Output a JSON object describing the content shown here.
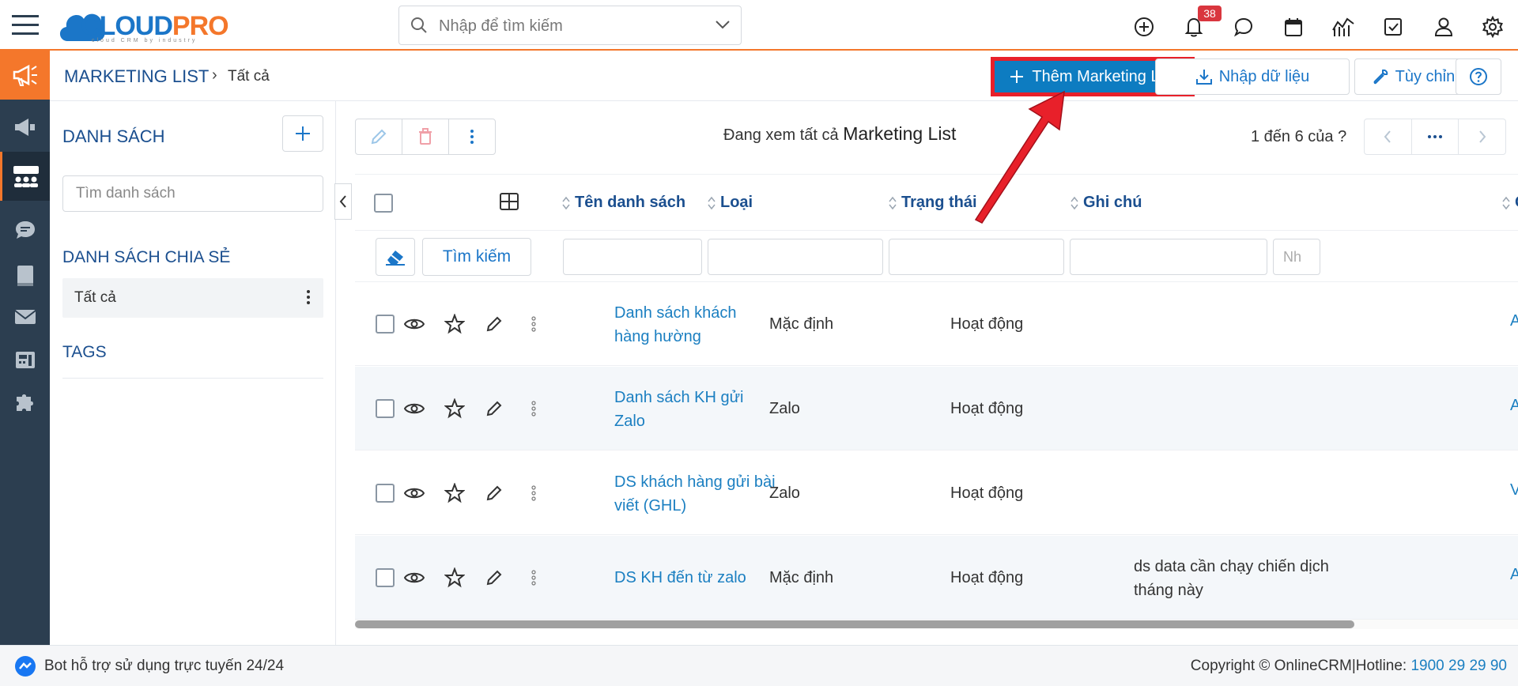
{
  "colors": {
    "brand_blue": "#1b76c8",
    "brand_orange": "#f4772b",
    "sidebar": "#2c3e50",
    "primary_button": "#0d7cc1",
    "highlight_red": "#e8202a",
    "link": "#1b7fc1"
  },
  "app": {
    "logo_cloud": "CLOUD",
    "logo_pro": "PRO",
    "logo_tagline": "cloud CRM by industry"
  },
  "search": {
    "placeholder": "Nhập để tìm kiếm"
  },
  "notifications": {
    "count": "38"
  },
  "top_icons": [
    "plus-circle-icon",
    "bell-icon",
    "chat-icon",
    "calendar-icon",
    "report-chart-icon",
    "task-check-icon",
    "user-icon",
    "gear-icon"
  ],
  "rail_icons": [
    "megaphone-icon",
    "campaign-icon",
    "group-icon",
    "message-icon",
    "book-icon",
    "mail-icon",
    "fax-icon",
    "puzzle-icon"
  ],
  "breadcrumb": {
    "module": "MARKETING LIST",
    "current": "Tất cả"
  },
  "actions": {
    "add": "Thêm Marketing List",
    "import": "Nhập dữ liệu",
    "customize": "Tùy chỉnh"
  },
  "panel": {
    "lists_title": "DANH SÁCH",
    "search_placeholder": "Tìm danh sách",
    "shared_title": "DANH SÁCH CHIA SẺ",
    "shared_item": "Tất cả",
    "tags_title": "TAGS"
  },
  "listing": {
    "viewing_prefix": "Đang xem tất cả",
    "viewing_module": "Marketing List",
    "pager_text": "1 đến 6 của",
    "pager_question": "?",
    "search_button": "Tìm kiếm",
    "columns": [
      "Tên danh sách",
      "Loại",
      "Trạng thái",
      "Ghi chú",
      "G"
    ],
    "filter_partial_placeholder": "Nh",
    "rows": [
      {
        "name": "Danh sách khách hàng hường",
        "type": "Mặc định",
        "status": "Hoạt động",
        "note": "",
        "owner": "Ad"
      },
      {
        "name": "Danh sách KH gửi Zalo",
        "type": "Zalo",
        "status": "Hoạt động",
        "note": "",
        "owner": "Ad"
      },
      {
        "name": "DS khách hàng gửi bài viết (GHL)",
        "type": "Zalo",
        "status": "Hoạt động",
        "note": "",
        "owner": "Vũ"
      },
      {
        "name": "DS KH đến từ zalo",
        "type": "Mặc định",
        "status": "Hoạt động",
        "note": "ds data cần chạy chiến dịch tháng này",
        "owner": "Ad"
      }
    ]
  },
  "footer": {
    "bot": "Bot hỗ trợ sử dụng trực tuyến 24/24",
    "copyright": "Copyright © OnlineCRM|Hotline:",
    "hotline": "1900 29 29 90"
  }
}
